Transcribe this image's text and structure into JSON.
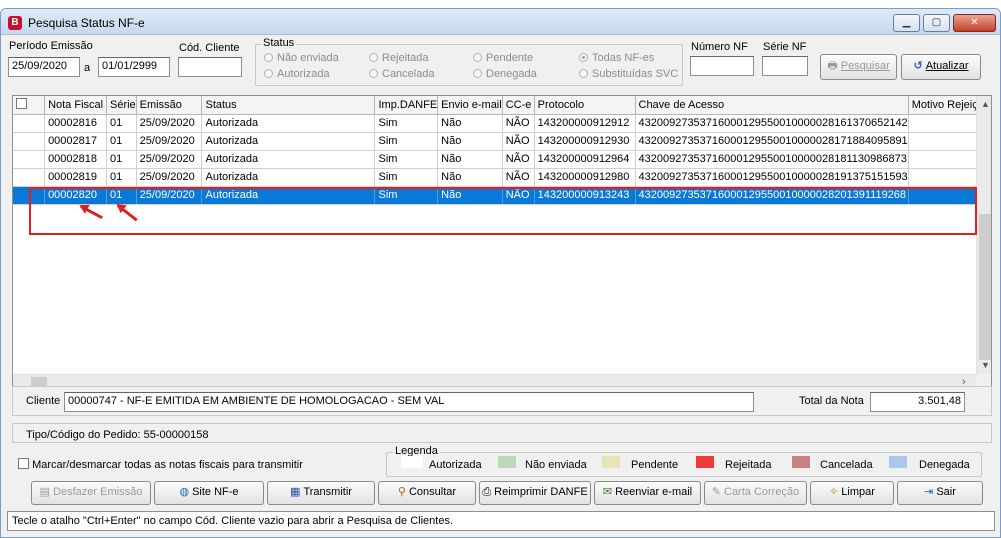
{
  "window": {
    "title": "Pesquisa Status NF-e",
    "app_icon": "B"
  },
  "filters": {
    "periodo_label": "Período Emissão",
    "date_from": "25/09/2020",
    "date_sep": "a",
    "date_to": "01/01/2999",
    "cliente_label": "Cód. Cliente",
    "cliente_value": "",
    "status_label": "Status",
    "status_options": [
      "Não enviada",
      "Autorizada",
      "Rejeitada",
      "Cancelada",
      "Pendente",
      "Denegada",
      "Todas NF-es",
      "Substituídas SVC"
    ],
    "numero_label": "Número NF",
    "numero_value": "",
    "serie_label": "Série NF",
    "serie_value": "",
    "pesquisar_label": "Pesquisar",
    "atualizar_label": "Atualizar"
  },
  "grid": {
    "columns": [
      "Nota Fiscal",
      "Série",
      "Emissão",
      "Status",
      "Imp.DANFE",
      "Envio e-mail",
      "CC-e",
      "Protocolo",
      "Chave de Acesso",
      "Motivo Rejeição"
    ],
    "rows": [
      [
        "00002816",
        "01",
        "25/09/2020",
        "Autorizada",
        "Sim",
        "Não",
        "NÃO",
        "143200000912912",
        "43200927353716000129550010000028161370652142",
        ""
      ],
      [
        "00002817",
        "01",
        "25/09/2020",
        "Autorizada",
        "Sim",
        "Não",
        "NÃO",
        "143200000912930",
        "43200927353716000129550010000028171884095891",
        ""
      ],
      [
        "00002818",
        "01",
        "25/09/2020",
        "Autorizada",
        "Sim",
        "Não",
        "NÃO",
        "143200000912964",
        "43200927353716000129550010000028181130986873",
        ""
      ],
      [
        "00002819",
        "01",
        "25/09/2020",
        "Autorizada",
        "Sim",
        "Não",
        "NÃO",
        "143200000912980",
        "43200927353716000129550010000028191375151593",
        ""
      ],
      [
        "00002820",
        "01",
        "25/09/2020",
        "Autorizada",
        "Sim",
        "Não",
        "NÃO",
        "143200000913243",
        "43200927353716000129550010000028201391119268",
        ""
      ]
    ]
  },
  "cliente": {
    "label": "Cliente",
    "value": "00000747 - NF-E EMITIDA EM AMBIENTE DE HOMOLOGACAO - SEM VAL",
    "total_label": "Total da Nota",
    "total_value": "3.501,48"
  },
  "pedido": {
    "text": "Tipo/Código do Pedido: 55-00000158"
  },
  "marcar_label": "Marcar/desmarcar todas as notas fiscais para transmitir",
  "legend": {
    "title": "Legenda",
    "items": [
      {
        "label": "Autorizada",
        "color": "#ffffff"
      },
      {
        "label": "Não enviada",
        "color": "#b9d9b9"
      },
      {
        "label": "Pendente",
        "color": "#e8e4b8"
      },
      {
        "label": "Rejeitada",
        "color": "#ee3a3a"
      },
      {
        "label": "Cancelada",
        "color": "#c98080"
      },
      {
        "label": "Denegada",
        "color": "#a9c8ec"
      }
    ]
  },
  "buttons": {
    "desfazer": "Desfazer Emissão",
    "site": "Site NF-e",
    "transmitir": "Transmitir",
    "consultar": "Consultar",
    "reimprimir": "Reimprimir DANFE",
    "reenviar": "Reenviar e-mail",
    "carta": "Carta Correção",
    "limpar": "Limpar",
    "sair": "Sair"
  },
  "status_bar": "Tecle o atalho \"Ctrl+Enter\" no campo Cód. Cliente vazio para abrir a Pesquisa de Clientes.",
  "colors": {
    "selection": "#0a78d7",
    "annotation": "#e02020"
  }
}
